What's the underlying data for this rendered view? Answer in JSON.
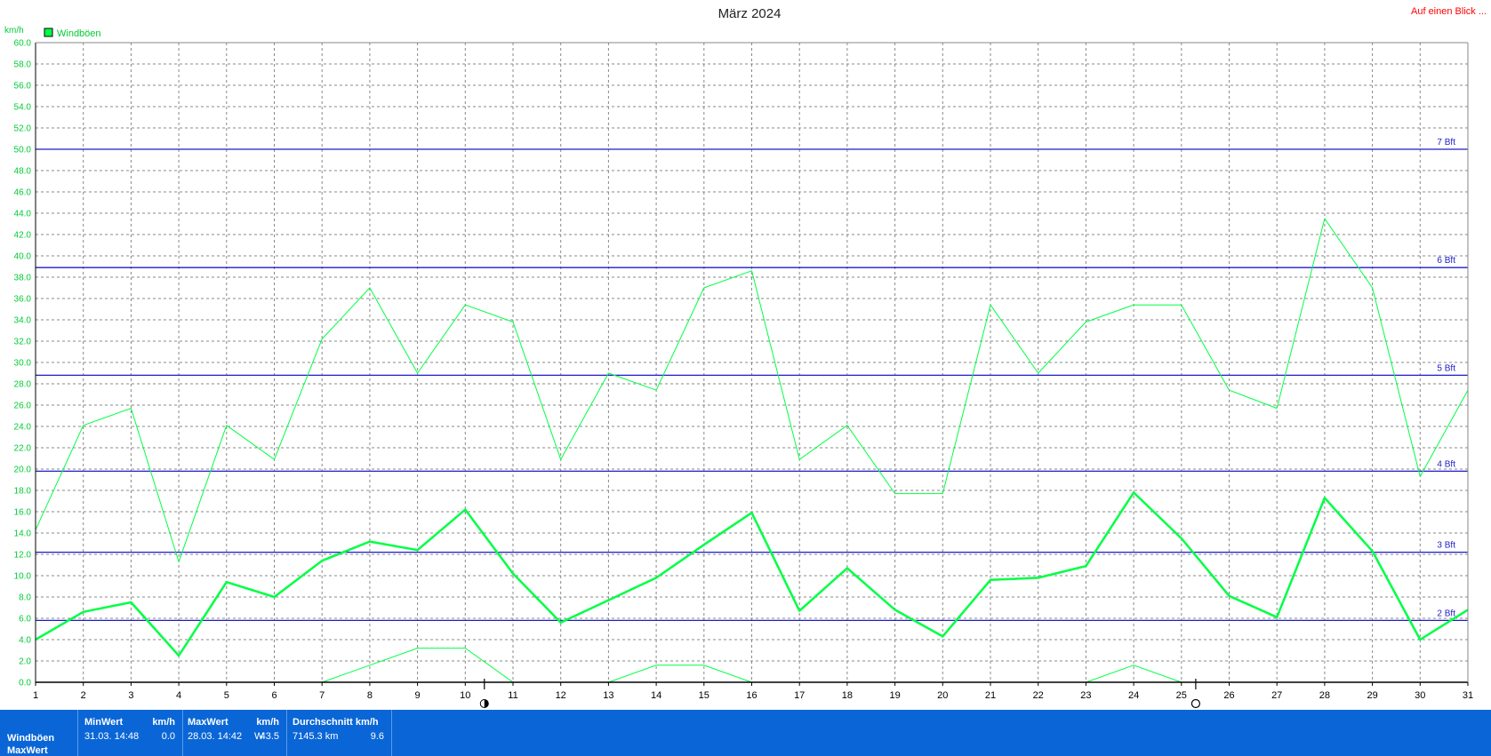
{
  "corner_link": "Auf einen Blick ...",
  "chart_data": {
    "type": "line",
    "title": "März 2024",
    "unit_label": "km/h",
    "ylim": [
      0,
      60
    ],
    "xlim": [
      1,
      31
    ],
    "y_ticks": [
      "0.0",
      "2.0",
      "4.0",
      "6.0",
      "8.0",
      "10.0",
      "12.0",
      "14.0",
      "16.0",
      "18.0",
      "20.0",
      "22.0",
      "24.0",
      "26.0",
      "28.0",
      "30.0",
      "32.0",
      "34.0",
      "36.0",
      "38.0",
      "40.0",
      "42.0",
      "44.0",
      "46.0",
      "48.0",
      "50.0",
      "52.0",
      "54.0",
      "56.0",
      "58.0",
      "60.0"
    ],
    "x_ticks": [
      "1",
      "2",
      "3",
      "4",
      "5",
      "6",
      "7",
      "8",
      "9",
      "10",
      "11",
      "12",
      "13",
      "14",
      "15",
      "16",
      "17",
      "18",
      "19",
      "20",
      "21",
      "22",
      "23",
      "24",
      "25",
      "26",
      "27",
      "28",
      "29",
      "30",
      "31"
    ],
    "legend": [
      {
        "label": "Windböen",
        "color": "#00ff44"
      }
    ],
    "grid": true,
    "beaufort_lines": [
      {
        "label": "2 Bft",
        "value": 5.8
      },
      {
        "label": "3 Bft",
        "value": 12.2
      },
      {
        "label": "4 Bft",
        "value": 19.8
      },
      {
        "label": "5 Bft",
        "value": 28.8
      },
      {
        "label": "6 Bft",
        "value": 38.9
      },
      {
        "label": "7 Bft",
        "value": 50.0
      }
    ],
    "series": [
      {
        "name": "max",
        "color": "#00ff44",
        "width": 1,
        "x": [
          1,
          2,
          3,
          4,
          5,
          6,
          7,
          8,
          9,
          10,
          11,
          12,
          13,
          14,
          15,
          16,
          17,
          18,
          19,
          20,
          21,
          22,
          23,
          24,
          25,
          26,
          27,
          28,
          29,
          30,
          31
        ],
        "y": [
          14.3,
          24.1,
          25.7,
          11.3,
          24.1,
          20.9,
          32.2,
          37.0,
          29.0,
          35.4,
          33.8,
          20.9,
          29.0,
          27.4,
          37.0,
          38.6,
          20.9,
          24.1,
          17.7,
          17.7,
          35.4,
          29.0,
          33.8,
          35.4,
          35.4,
          27.4,
          25.7,
          43.5,
          37.0,
          19.3,
          27.4
        ]
      },
      {
        "name": "avg",
        "color": "#00ff44",
        "width": 2.5,
        "x": [
          1,
          2,
          3,
          4,
          5,
          6,
          7,
          8,
          9,
          10,
          11,
          12,
          13,
          14,
          15,
          16,
          17,
          18,
          19,
          20,
          21,
          22,
          23,
          24,
          25,
          26,
          27,
          28,
          29,
          30,
          31
        ],
        "y": [
          4.0,
          6.6,
          7.5,
          2.5,
          9.4,
          8.0,
          11.4,
          13.2,
          12.4,
          16.2,
          10.2,
          5.6,
          7.7,
          9.8,
          12.9,
          15.9,
          6.7,
          10.7,
          6.8,
          4.3,
          9.6,
          9.8,
          10.9,
          17.8,
          13.5,
          8.1,
          6.1,
          17.3,
          12.3,
          4.0,
          6.8
        ]
      },
      {
        "name": "min",
        "color": "#00ff44",
        "width": 1,
        "x": [
          7,
          8,
          9,
          10,
          11,
          13,
          14,
          15,
          16,
          23,
          24,
          25
        ],
        "y": [
          0.0,
          1.6,
          3.2,
          3.2,
          0.0,
          0.0,
          1.6,
          1.6,
          0.0,
          0.0,
          1.6,
          0.0
        ]
      }
    ],
    "moon_markers": [
      {
        "x": 10.4,
        "icon": "new-moon-icon"
      },
      {
        "x": 25.3,
        "icon": "full-moon-icon"
      }
    ]
  },
  "footer": {
    "row_labels": [
      "Windböen",
      "MaxWert"
    ],
    "min": {
      "title": "MinWert",
      "unit": "km/h",
      "date": "31.03. 14:48",
      "value": "0.0"
    },
    "max": {
      "title": "MaxWert",
      "unit": "km/h",
      "date": "28.03. 14:42",
      "dir": "W",
      "value": "43.5"
    },
    "avg": {
      "title": "Durchschnitt km/h",
      "distance": "7145.3 km",
      "value": "9.6"
    }
  }
}
